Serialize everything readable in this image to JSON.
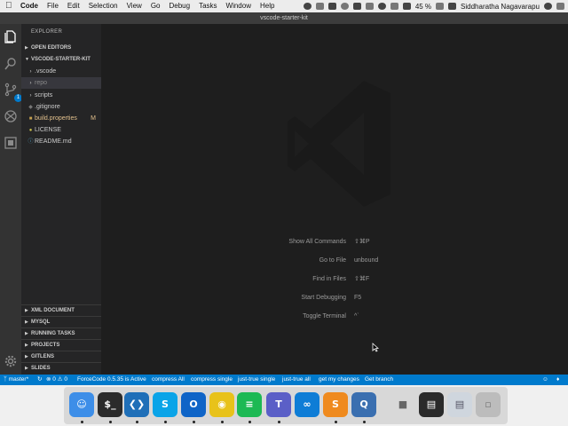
{
  "menubar": {
    "items": [
      "Code",
      "File",
      "Edit",
      "Selection",
      "View",
      "Go",
      "Debug",
      "Tasks",
      "Window",
      "Help"
    ],
    "battery": "45 %",
    "user": "Siddharatha Nagavarapu"
  },
  "window": {
    "title": "vscode-starter-kit"
  },
  "activity": {
    "scm_badge": "1"
  },
  "sidebar": {
    "title": "EXPLORER",
    "open_editors": "OPEN EDITORS",
    "workspace": "VSCODE-STARTER-KIT",
    "files": [
      {
        "name": ".vscode",
        "status": ""
      },
      {
        "name": "repo",
        "status": ""
      },
      {
        "name": "scripts",
        "status": ""
      },
      {
        "name": ".gitignore",
        "status": ""
      },
      {
        "name": "build.properties",
        "status": "M"
      },
      {
        "name": "LICENSE",
        "status": ""
      },
      {
        "name": "README.md",
        "status": ""
      }
    ],
    "sections": [
      "XML DOCUMENT",
      "MYSQL",
      "RUNNING TASKS",
      "PROJECTS",
      "GITLENS",
      "SLIDES"
    ]
  },
  "editor": {
    "shortcuts": [
      {
        "label": "Show All Commands",
        "key": "⇧⌘P"
      },
      {
        "label": "Go to File",
        "key": "unbound"
      },
      {
        "label": "Find in Files",
        "key": "⇧⌘F"
      },
      {
        "label": "Start Debugging",
        "key": "F5"
      },
      {
        "label": "Toggle Terminal",
        "key": "^`"
      }
    ]
  },
  "statusbar": {
    "branch": "master*",
    "errors": "0",
    "warnings": "0",
    "items": [
      "ForceCode 0.5.35 is Active",
      "compress All",
      "compress single",
      "just-true single",
      "just-true all",
      "get my changes",
      "Get branch"
    ]
  },
  "colors": {
    "accent": "#007acc",
    "modified": "#e2c08d",
    "sidebar": "#252526",
    "editor": "#1e1e1e"
  },
  "dock": {
    "apps": [
      {
        "icon": "finder-icon",
        "color": "#3d8ee8"
      },
      {
        "icon": "terminal-icon",
        "color": "#2b2b2b"
      },
      {
        "icon": "vscode-icon",
        "color": "#1f6fb8"
      },
      {
        "icon": "skype-icon",
        "color": "#0aa4e8"
      },
      {
        "icon": "outlook-icon",
        "color": "#0f64c7"
      },
      {
        "icon": "chrome-icon",
        "color": "#e8c21a"
      },
      {
        "icon": "spotify-icon",
        "color": "#1db954"
      },
      {
        "icon": "teams-icon",
        "color": "#5b5fc7"
      },
      {
        "icon": "dictionary-icon",
        "color": "#0e7dd6"
      },
      {
        "icon": "other-app-icon",
        "color": "#1d8fe0"
      },
      {
        "icon": "sublime-icon",
        "color": "#ef8a1e"
      },
      {
        "icon": "quicktime-icon",
        "color": "#3a6fb0"
      },
      {
        "icon": "preview-icon",
        "color": "#d8d8d8"
      },
      {
        "icon": "window-thumbnail-icon",
        "color": "#2a2a2a"
      },
      {
        "icon": "document-icon",
        "color": "#cfd6de"
      },
      {
        "icon": "trash-icon",
        "color": "#bcbcbc"
      }
    ]
  }
}
